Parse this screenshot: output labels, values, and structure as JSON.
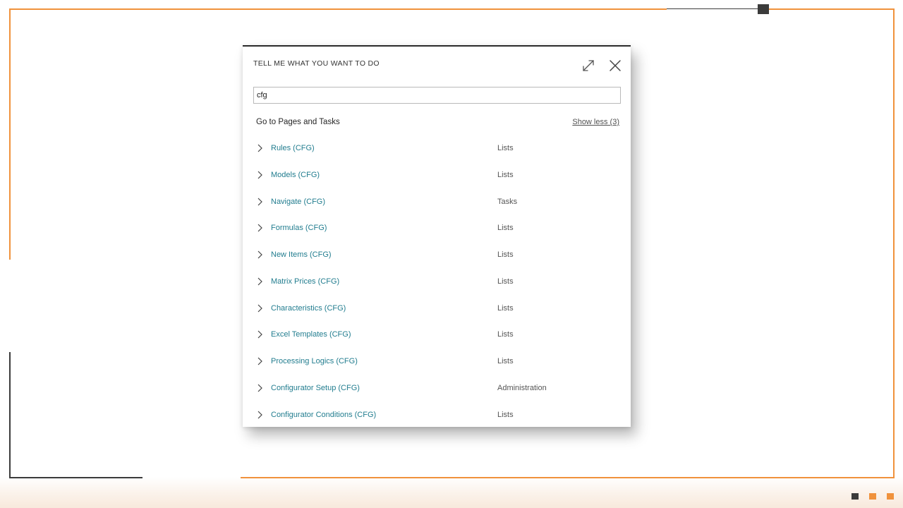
{
  "dialog": {
    "title": "TELL ME WHAT YOU WANT TO DO",
    "expand_icon": "expand-icon",
    "close_icon": "close-icon",
    "search": {
      "value": "cfg",
      "placeholder": ""
    },
    "section_title": "Go to Pages and Tasks",
    "show_less_label": "Show less (3)",
    "results": [
      {
        "name": "Rules (CFG)",
        "category": "Lists"
      },
      {
        "name": "Models (CFG)",
        "category": "Lists"
      },
      {
        "name": "Navigate (CFG)",
        "category": "Tasks"
      },
      {
        "name": "Formulas (CFG)",
        "category": "Lists"
      },
      {
        "name": "New Items (CFG)",
        "category": "Lists"
      },
      {
        "name": "Matrix Prices (CFG)",
        "category": "Lists"
      },
      {
        "name": "Characteristics (CFG)",
        "category": "Lists"
      },
      {
        "name": "Excel Templates (CFG)",
        "category": "Lists"
      },
      {
        "name": "Processing Logics (CFG)",
        "category": "Lists"
      },
      {
        "name": "Configurator Setup (CFG)",
        "category": "Administration"
      },
      {
        "name": "Configurator Conditions (CFG)",
        "category": "Lists"
      }
    ]
  },
  "colors": {
    "accent_orange": "#f0923c",
    "frame_dark": "#3b3b3b",
    "link_teal": "#227d8f"
  }
}
